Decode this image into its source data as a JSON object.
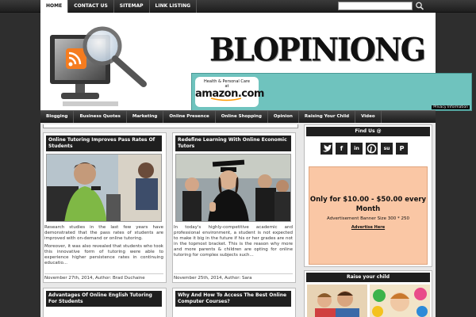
{
  "top_nav": {
    "items": [
      "HOME",
      "CONTACT US",
      "SITEMAP",
      "LINK LISTING"
    ]
  },
  "search": {
    "placeholder": ""
  },
  "logo": {
    "text": "BLOPINIONG"
  },
  "ad": {
    "line1": "Health & Personal Care",
    "line2": "at",
    "brand": "amazon.com",
    "privacy": "Privacy Information"
  },
  "main_nav": {
    "items": [
      "Blogging",
      "Business Quotes",
      "Marketing",
      "Online Presence",
      "Online Shopping",
      "Opinion",
      "Raising Your Child",
      "Video"
    ]
  },
  "posts": [
    {
      "title": "Online Tutoring Improves Pass Rates Of Students",
      "p1": "Research studies in the last few years have demonstrated that the pass rates of students are improved with on-demand or online tutoring.",
      "p2": "Moreover, it was also revealed that students who took this innovative form of tutoring were able to experience higher persistence rates in continuing educatio...",
      "meta": "November 27th, 2014, Author: Brad Duchaine"
    },
    {
      "title": "Redefine Learning With Online Economic Tutors",
      "p1": "In today's highly-competitive academic and professional environment, a student is not expected to make it big in the future if his or her grades are not in the topmost bracket. This is the reason why more and more parents & children are opting for online tutoring for complex subjects such...",
      "p2": "",
      "meta": "November 25th, 2014, Author: Sara"
    },
    {
      "title": "Advantages Of Online English Tutoring For Students",
      "p1": "",
      "p2": "",
      "meta": ""
    },
    {
      "title": "Why And How To Access The Best Online Computer Courses?",
      "p1": "",
      "p2": "",
      "meta": ""
    }
  ],
  "sidebar": {
    "find_us": "Find Us @",
    "social": [
      "twitter-icon",
      "facebook-icon",
      "linkedin-icon",
      "pinterest-icon",
      "stumbleupon-icon",
      "pocket-icon"
    ],
    "promo_title": "Only for $10.00 - $50.00 every Month",
    "promo_size": "Advertisement Banner Size 300 * 250",
    "promo_link": "Advertise Here",
    "raise_child": "Raise your child"
  },
  "colors": {
    "ad_bg": "#6fc3be",
    "promo_bg": "#fac7a5",
    "bar_dark": "#1f1f1f"
  }
}
